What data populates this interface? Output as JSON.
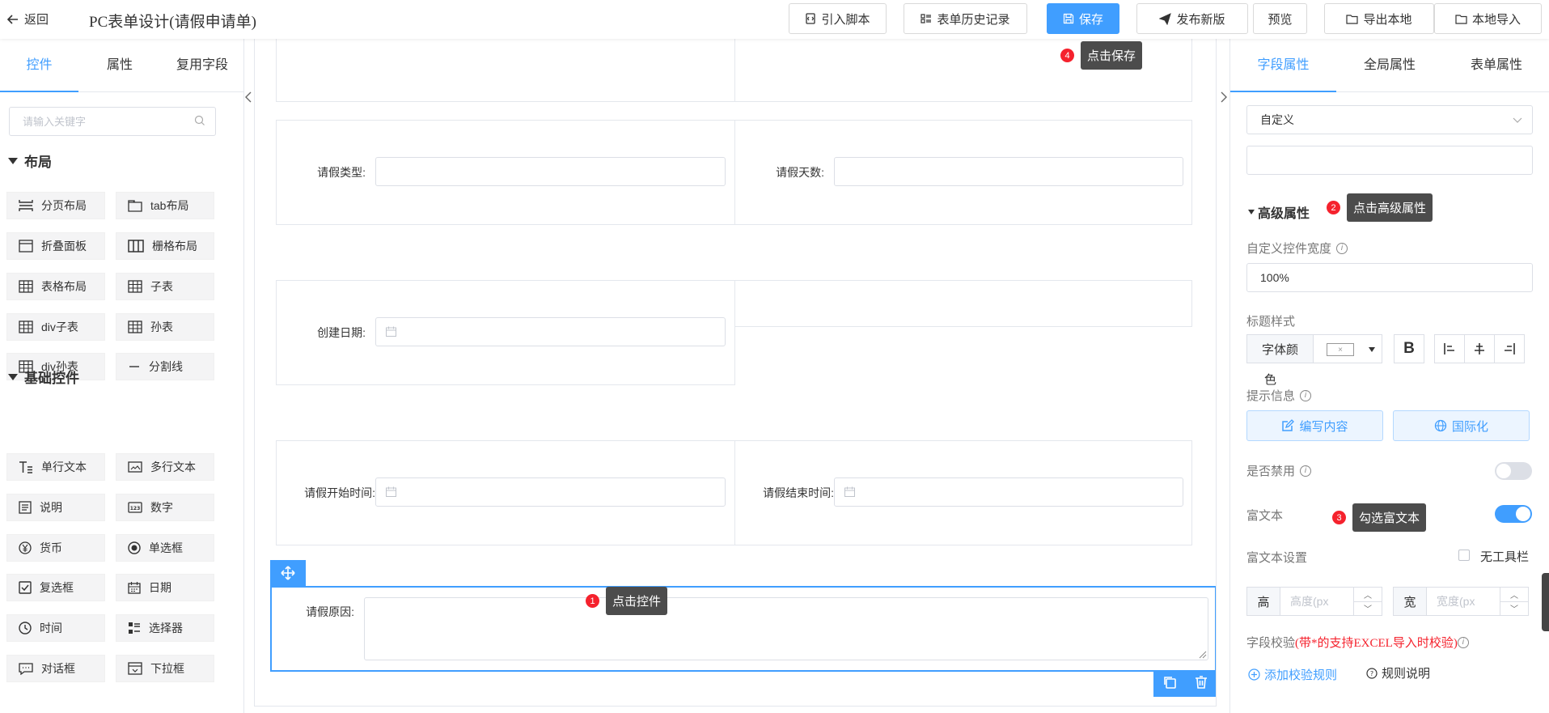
{
  "header": {
    "back_label": "返回",
    "title": "PC表单设计(请假申请单)",
    "buttons": {
      "script": "引入脚本",
      "history": "表单历史记录",
      "save": "保存",
      "publish": "发布新版",
      "preview": "预览",
      "export": "导出本地",
      "import": "本地导入"
    }
  },
  "left_panel": {
    "tabs": [
      "控件",
      "属性",
      "复用字段"
    ],
    "active_tab": 0,
    "search_placeholder": "请输入关键字",
    "sections": {
      "layout": {
        "title": "布局",
        "items": [
          "分页布局",
          "tab布局",
          "折叠面板",
          "栅格布局",
          "表格布局",
          "子表",
          "div子表",
          "孙表",
          "div孙表",
          "分割线"
        ]
      },
      "basic": {
        "title": "基础控件",
        "items": [
          "单行文本",
          "多行文本",
          "说明",
          "数字",
          "货币",
          "单选框",
          "复选框",
          "日期",
          "时间",
          "选择器",
          "对话框",
          "下拉框"
        ]
      }
    }
  },
  "canvas": {
    "fields": {
      "leave_type": "请假类型:",
      "leave_days": "请假天数:",
      "create_date": "创建日期:",
      "start_time": "请假开始时间:",
      "end_time": "请假结束时间:",
      "reason": "请假原因:"
    }
  },
  "tips": {
    "t1": {
      "num": "1",
      "text": "点击控件"
    },
    "t2": {
      "num": "2",
      "text": "点击高级属性"
    },
    "t3": {
      "num": "3",
      "text": "勾选富文本"
    },
    "t4": {
      "num": "4",
      "text": "点击保存"
    }
  },
  "right_panel": {
    "tabs": [
      "字段属性",
      "全局属性",
      "表单属性"
    ],
    "active_tab": 0,
    "custom_select": "自定义",
    "advanced_title": "高级属性",
    "width_label": "自定义控件宽度",
    "width_value": "100%",
    "title_style_label": "标题样式",
    "font_color_label_1": "字体颜",
    "font_color_label_2": "色",
    "bold_label": "B",
    "hint_label": "提示信息",
    "edit_content": "编写内容",
    "i18n": "国际化",
    "disabled_label": "是否禁用",
    "disabled_on": false,
    "richtext_label": "富文本",
    "richtext_on": true,
    "richtext_settings_label": "富文本设置",
    "no_toolbar_label": "无工具栏",
    "height_addon": "高",
    "height_placeholder": "高度(px",
    "width_addon": "宽",
    "width_placeholder": "宽度(px",
    "validation_label": "字段校验",
    "validation_note": "(带*的支持EXCEL导入时校验)",
    "add_rule": "添加校验规则",
    "rule_help": "规则说明"
  },
  "colors": {
    "primary": "#409eff",
    "danger": "#f5222d",
    "tip_bg": "#4c4c4c"
  }
}
